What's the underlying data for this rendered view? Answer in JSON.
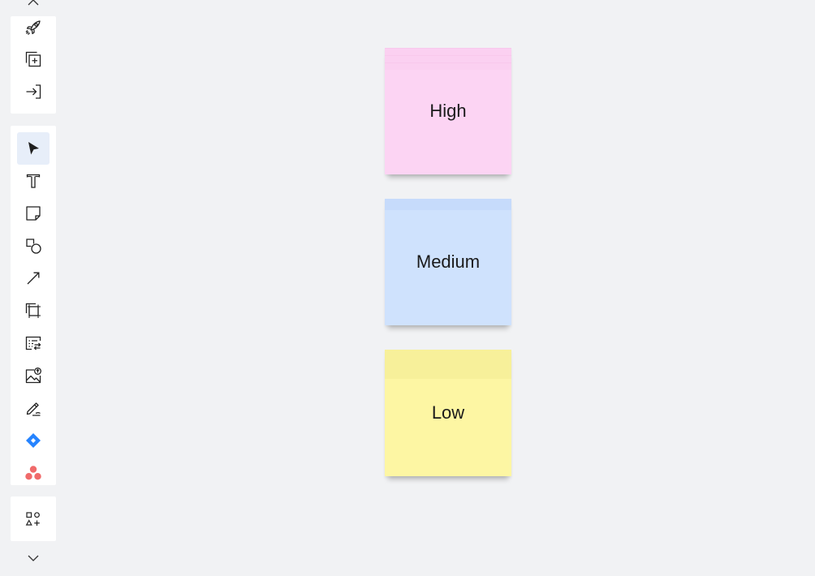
{
  "toolbar": {
    "top_actions": [
      {
        "name": "launch-icon"
      },
      {
        "name": "add-frame-icon"
      },
      {
        "name": "import-icon"
      }
    ],
    "tools": [
      {
        "name": "select-tool-icon",
        "active": true
      },
      {
        "name": "text-tool-icon"
      },
      {
        "name": "sticky-note-tool-icon"
      },
      {
        "name": "shapes-tool-icon"
      },
      {
        "name": "connector-tool-icon"
      },
      {
        "name": "frame-tool-icon"
      },
      {
        "name": "card-tool-icon"
      },
      {
        "name": "image-upload-icon"
      },
      {
        "name": "pen-tool-icon"
      },
      {
        "name": "jira-app-icon"
      },
      {
        "name": "asana-app-icon"
      }
    ],
    "more_apps": {
      "name": "more-apps-icon"
    }
  },
  "colors": {
    "canvas": "#f1f2f4",
    "note_high": "#fcd4f3",
    "note_medium": "#cfe2fd",
    "note_low": "#fdf6a3",
    "jira_blue": "#2684ff",
    "asana_coral": "#f06a6a",
    "active_tool_bg": "#e7eef9"
  },
  "notes": [
    {
      "label": "High",
      "color": "#fcd4f3"
    },
    {
      "label": "Medium",
      "color": "#cfe2fd"
    },
    {
      "label": "Low",
      "color": "#fdf6a3"
    }
  ]
}
